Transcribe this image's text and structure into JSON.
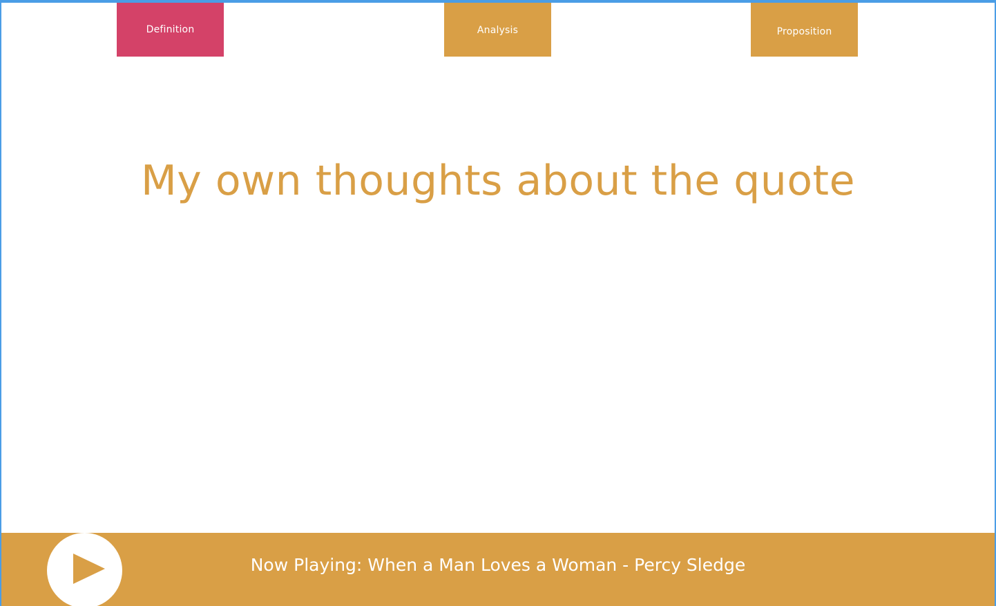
{
  "colors": {
    "accent": "#d99f46",
    "active_tab": "#d44268",
    "frame_border": "#4a9de6",
    "background": "#ffffff",
    "text_on_accent": "#ffffff"
  },
  "nav": {
    "tabs": [
      {
        "label": "Definition",
        "active": true
      },
      {
        "label": "Analysis",
        "active": false
      },
      {
        "label": "Proposition",
        "active": false
      }
    ]
  },
  "main": {
    "headline": "My own thoughts about the quote"
  },
  "player": {
    "play_icon": "play-icon",
    "now_playing": "Now Playing: When a Man Loves a Woman - Percy Sledge"
  }
}
